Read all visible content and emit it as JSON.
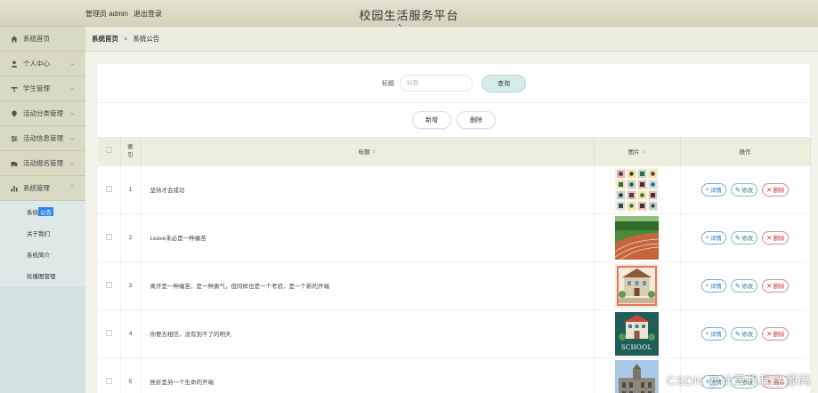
{
  "header": {
    "user_label": "管理员 admin",
    "logout_label": "退出登录",
    "site_title": "校园生活服务平台"
  },
  "sidebar": {
    "menus": [
      {
        "label": "系统首页",
        "icon": "home-icon",
        "chevron": ""
      },
      {
        "label": "个人中心",
        "icon": "user-icon",
        "chevron": "⌄"
      },
      {
        "label": "学生管理",
        "icon": "student-icon",
        "chevron": "⌄"
      },
      {
        "label": "活动分类管理",
        "icon": "category-icon",
        "chevron": "⌄"
      },
      {
        "label": "活动信息管理",
        "icon": "sliders-icon",
        "chevron": "⌄"
      },
      {
        "label": "活动报名管理",
        "icon": "truck-icon",
        "chevron": "⌄"
      },
      {
        "label": "系统管理",
        "icon": "bar-chart-icon",
        "chevron": "⌃"
      }
    ],
    "sub_items": [
      {
        "label_a": "系统",
        "label_b": "公告"
      },
      {
        "label_a": "关于我们",
        "label_b": ""
      },
      {
        "label_a": "系统简介",
        "label_b": ""
      },
      {
        "label_a": "轮播图管理",
        "label_b": ""
      }
    ]
  },
  "breadcrumb": {
    "home": "系统首页",
    "sep": ">",
    "current": "系统公告"
  },
  "search": {
    "label": "标题",
    "placeholder": "标题",
    "button": "查询"
  },
  "actions": {
    "add": "新增",
    "delete": "删除"
  },
  "table": {
    "headers": {
      "index": "索引",
      "title": "标题",
      "image": "图片",
      "ops": "操作",
      "sort_glyph": "⇕"
    },
    "rows": [
      {
        "index": "1",
        "title": "坚持才会成功",
        "thumb": "icon-grid"
      },
      {
        "index": "2",
        "title": "Leave未必是一种痛苦",
        "thumb": "running-track"
      },
      {
        "index": "3",
        "title": "离开是一种痛苦，是一种勇气，但同样也是一个考验，是一个新的开端",
        "thumb": "campus-illustration"
      },
      {
        "index": "4",
        "title": "你要去相信，没有到不了的明天",
        "thumb": "school-badge"
      },
      {
        "index": "5",
        "title": "挫折是另一个生命的开端",
        "thumb": "campus-building"
      }
    ],
    "ops": {
      "detail": "详情",
      "edit": "修改",
      "del": "删除"
    },
    "school_text": "SCHOOL"
  },
  "watermark": "CSDN @计算机程序源码",
  "colors": {
    "topbar": "#d4d4bc",
    "sidebar": "#d3e2e0",
    "active_highlight": "#2f86e8",
    "query_button": "#d6ecea",
    "detail": "#2d7cb5",
    "edit": "#2a8a85",
    "delete": "#cc3333"
  }
}
